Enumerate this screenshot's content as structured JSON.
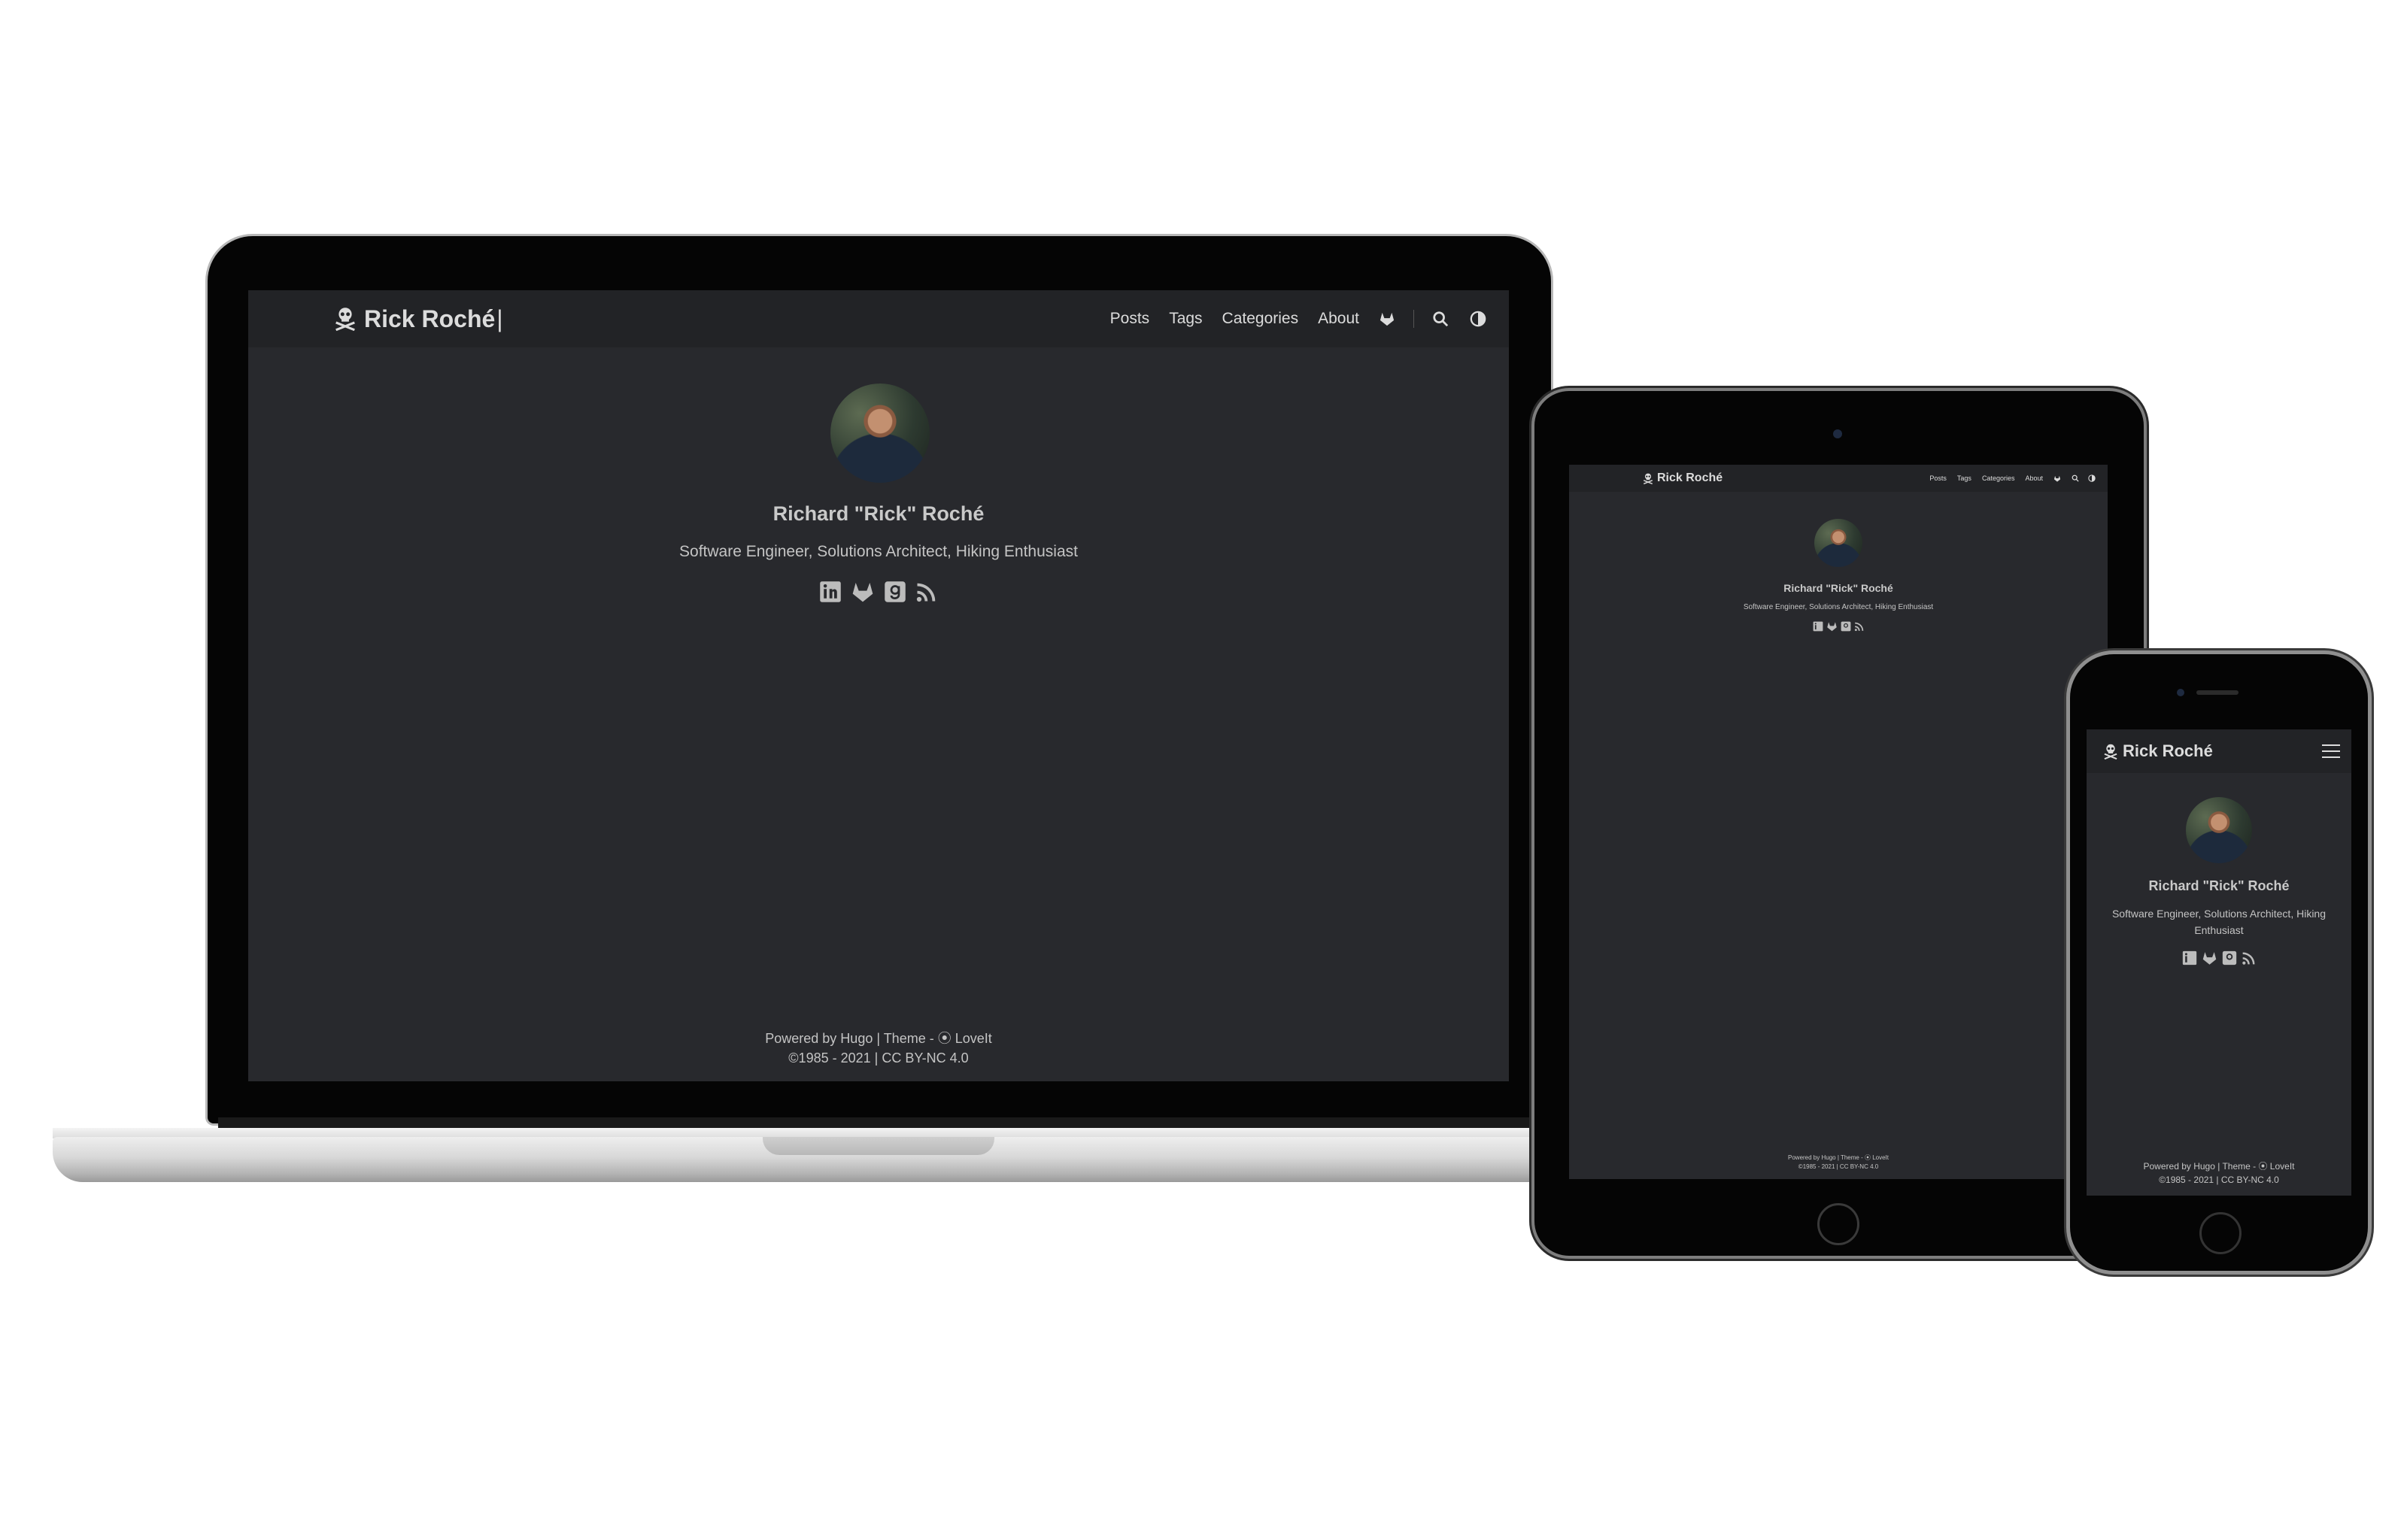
{
  "site": {
    "brand": "Rick Roché",
    "nav": [
      "Posts",
      "Tags",
      "Categories",
      "About"
    ],
    "profile_name": "Richard \"Rick\" Roché",
    "subtitle": "Software Engineer, Solutions Architect, Hiking Enthusiast",
    "social_icons": [
      "linkedin-icon",
      "gitlab-icon",
      "goodreads-icon",
      "rss-icon"
    ],
    "footer_line1": "Powered by Hugo | Theme - ⦿ LoveIt",
    "footer_line2": "©1985 - 2021 | CC BY-NC 4.0"
  },
  "colors": {
    "page_bg": "#28292d",
    "header_bg": "#222326",
    "text": "#c4c4c4"
  }
}
